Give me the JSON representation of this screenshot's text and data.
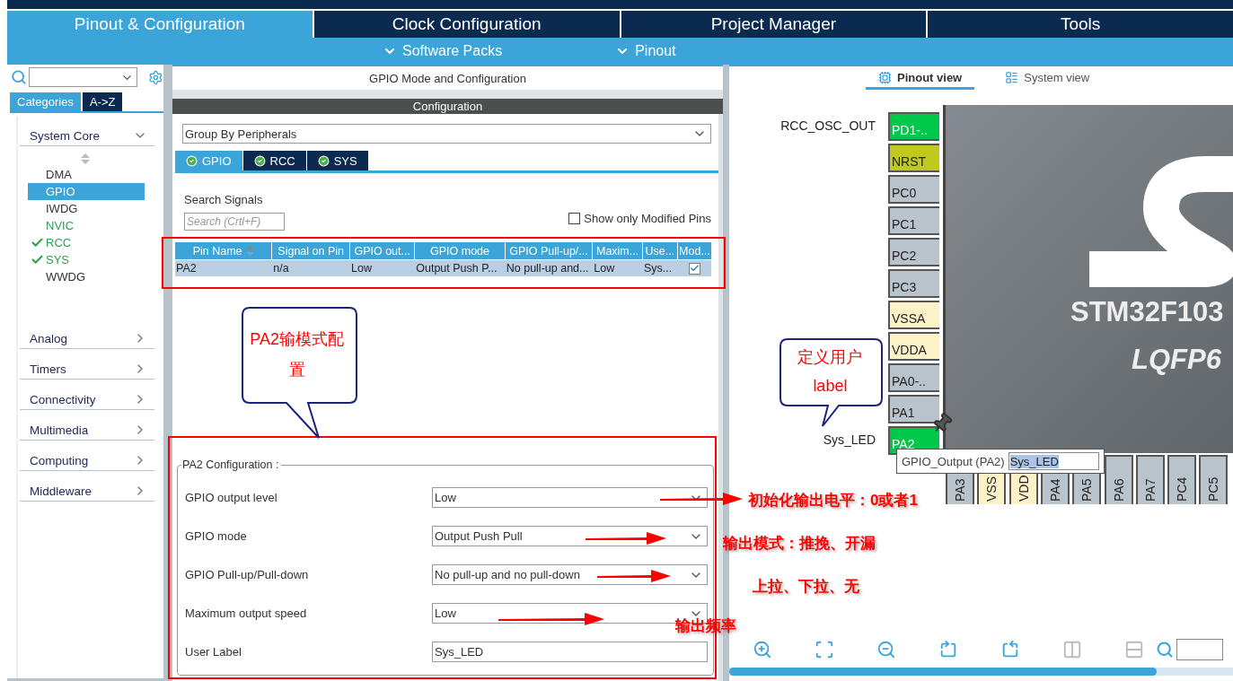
{
  "top_tabs": [
    {
      "label": "Pinout & Configuration",
      "selected": true
    },
    {
      "label": "Clock Configuration",
      "selected": false
    },
    {
      "label": "Project Manager",
      "selected": false
    },
    {
      "label": "Tools",
      "selected": false
    }
  ],
  "sub_menu": [
    "Software Packs",
    "Pinout"
  ],
  "left_panel": {
    "tabs": [
      {
        "label": "Categories",
        "selected": true
      },
      {
        "label": "A->Z",
        "selected": false
      }
    ],
    "groups": [
      {
        "label": "System Core",
        "expanded": true,
        "items": [
          {
            "label": "DMA",
            "selected": false,
            "active": false,
            "checked": false
          },
          {
            "label": "GPIO",
            "selected": true,
            "active": false,
            "checked": false
          },
          {
            "label": "IWDG",
            "selected": false,
            "active": false,
            "checked": false
          },
          {
            "label": "NVIC",
            "selected": false,
            "active": true,
            "checked": false
          },
          {
            "label": "RCC",
            "selected": false,
            "active": true,
            "checked": true
          },
          {
            "label": "SYS",
            "selected": false,
            "active": true,
            "checked": true
          },
          {
            "label": "WWDG",
            "selected": false,
            "active": false,
            "checked": false
          }
        ]
      },
      {
        "label": "Analog",
        "expanded": false
      },
      {
        "label": "Timers",
        "expanded": false
      },
      {
        "label": "Connectivity",
        "expanded": false
      },
      {
        "label": "Multimedia",
        "expanded": false
      },
      {
        "label": "Computing",
        "expanded": false
      },
      {
        "label": "Middleware",
        "expanded": false
      }
    ]
  },
  "middle_panel": {
    "title": "GPIO Mode and Configuration",
    "section": "Configuration",
    "group_select": "Group By Peripherals",
    "tabs": [
      {
        "label": "GPIO",
        "selected": true
      },
      {
        "label": "RCC",
        "selected": false
      },
      {
        "label": "SYS",
        "selected": false
      }
    ],
    "search_label": "Search Signals",
    "search": {
      "placeholder": "Search (Crtl+F)"
    },
    "modified_only": {
      "label": "Show only Modified Pins",
      "checked": false
    },
    "table": {
      "columns": [
        "Pin Name",
        "Signal on Pin",
        "GPIO out...",
        "GPIO mode",
        "GPIO Pull-up/...",
        "Maxim...",
        "Use...",
        "Mod..."
      ],
      "rows": [
        {
          "selected": true,
          "cells": [
            "PA2",
            "n/a",
            "Low",
            "Output Push P...",
            "No pull-up and...",
            "Low",
            "Sys..."
          ],
          "modified": true
        }
      ]
    },
    "config": {
      "legend": "PA2 Configuration :",
      "fields": [
        {
          "label": "GPIO output level",
          "value": "Low",
          "kind": "select"
        },
        {
          "label": "GPIO mode",
          "value": "Output Push Pull",
          "kind": "select"
        },
        {
          "label": "GPIO Pull-up/Pull-down",
          "value": "No pull-up and no pull-down",
          "kind": "select"
        },
        {
          "label": "Maximum output speed",
          "value": "Low",
          "kind": "select"
        },
        {
          "label": "User Label",
          "value": "Sys_LED",
          "kind": "text"
        }
      ]
    }
  },
  "right_panel": {
    "tabs": [
      {
        "label": "Pinout view",
        "selected": true,
        "kind": "chip"
      },
      {
        "label": "System view",
        "selected": false,
        "kind": "list"
      }
    ],
    "chip": {
      "name": "STM32F103",
      "package": "LQFP6"
    },
    "left_pins": [
      {
        "name": "PD1-..",
        "kind": "assigned",
        "label": "RCC_OSC_OUT"
      },
      {
        "name": "NRST",
        "kind": "reset"
      },
      {
        "name": "PC0",
        "kind": "io"
      },
      {
        "name": "PC1",
        "kind": "io"
      },
      {
        "name": "PC2",
        "kind": "io"
      },
      {
        "name": "PC3",
        "kind": "io"
      },
      {
        "name": "VSSA",
        "kind": "power"
      },
      {
        "name": "VDDA",
        "kind": "power"
      },
      {
        "name": "PA0-..",
        "kind": "io"
      },
      {
        "name": "PA1",
        "kind": "io"
      },
      {
        "name": "PA2",
        "kind": "assigned",
        "label": "Sys_LED"
      }
    ],
    "bottom_pins": [
      {
        "name": "PA3",
        "kind": "io"
      },
      {
        "name": "VSS",
        "kind": "power"
      },
      {
        "name": "VDD",
        "kind": "power"
      },
      {
        "name": "PA4",
        "kind": "io"
      },
      {
        "name": "PA5",
        "kind": "io"
      },
      {
        "name": "PA6",
        "kind": "io"
      },
      {
        "name": "PA7",
        "kind": "io"
      },
      {
        "name": "PC4",
        "kind": "io"
      },
      {
        "name": "PC5",
        "kind": "io"
      }
    ],
    "tooltip": {
      "signal": "GPIO_Output (PA2)",
      "value": "Sys_LED"
    },
    "toolbar": [
      {
        "kind": "zoom-in",
        "disabled": false
      },
      {
        "kind": "fit",
        "disabled": false
      },
      {
        "kind": "zoom-out",
        "disabled": false
      },
      {
        "kind": "rotate-right",
        "disabled": false
      },
      {
        "kind": "rotate-left",
        "disabled": false
      },
      {
        "kind": "split-vertical",
        "disabled": true
      },
      {
        "kind": "split-horizontal",
        "disabled": true
      }
    ]
  },
  "annotations": {
    "callouts": [
      "PA2输模式配置",
      "定义用户label"
    ],
    "notes": [
      "初始化输出电平：0或者1",
      "输出模式：推挽、开漏",
      "上拉、下拉、无",
      "输出频率"
    ]
  }
}
